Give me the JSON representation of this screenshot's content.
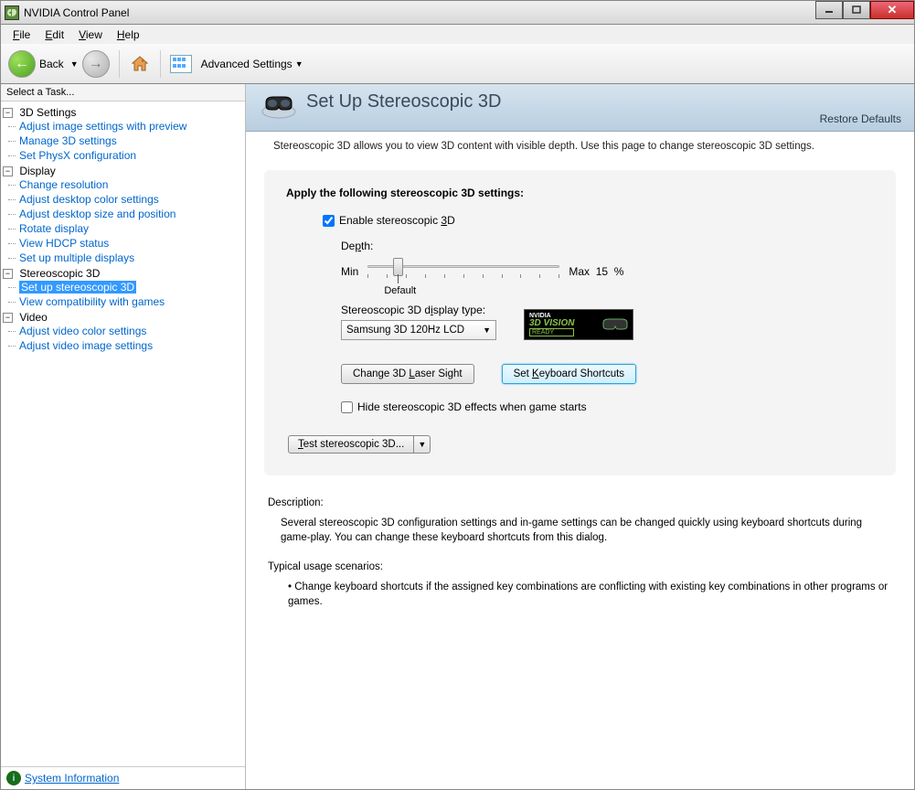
{
  "window": {
    "title": "NVIDIA Control Panel"
  },
  "menubar": {
    "file": "File",
    "edit": "Edit",
    "view": "View",
    "help": "Help"
  },
  "toolbar": {
    "back": "Back",
    "advanced": "Advanced Settings"
  },
  "sidebar": {
    "header": "Select a Task...",
    "groups": [
      {
        "label": "3D Settings",
        "items": [
          "Adjust image settings with preview",
          "Manage 3D settings",
          "Set PhysX configuration"
        ]
      },
      {
        "label": "Display",
        "items": [
          "Change resolution",
          "Adjust desktop color settings",
          "Adjust desktop size and position",
          "Rotate display",
          "View HDCP status",
          "Set up multiple displays"
        ]
      },
      {
        "label": "Stereoscopic 3D",
        "items": [
          "Set up stereoscopic 3D",
          "View compatibility with games"
        ]
      },
      {
        "label": "Video",
        "items": [
          "Adjust video color settings",
          "Adjust video image settings"
        ]
      }
    ],
    "selected": "Set up stereoscopic 3D",
    "system_info": "System Information"
  },
  "page": {
    "title": "Set Up Stereoscopic 3D",
    "restore": "Restore Defaults",
    "intro": "Stereoscopic 3D allows you to view 3D content with visible depth. Use this page to change stereoscopic 3D settings."
  },
  "settings": {
    "panel_title": "Apply the following stereoscopic 3D settings:",
    "enable_label": "Enable stereoscopic 3D",
    "enable_checked": true,
    "depth_label": "Depth:",
    "depth_min": "Min",
    "depth_max": "Max",
    "depth_value": "15",
    "depth_unit": "%",
    "depth_default": "Default",
    "display_type_label": "Stereoscopic 3D display type:",
    "display_type_value": "Samsung 3D 120Hz LCD",
    "badge": {
      "brand": "NVIDIA",
      "product": "3D VISION",
      "ready": "READY"
    },
    "btn_laser": "Change 3D Laser Sight",
    "btn_shortcuts": "Set Keyboard Shortcuts",
    "hide_label": "Hide stereoscopic 3D effects when game starts",
    "hide_checked": false,
    "test_btn": "Test stereoscopic 3D..."
  },
  "description": {
    "title": "Description:",
    "body": "Several stereoscopic 3D configuration settings and in-game settings can be changed quickly using keyboard shortcuts during game-play. You can change these keyboard shortcuts from this dialog.",
    "scenarios_title": "Typical usage scenarios:",
    "scenario1": "Change keyboard shortcuts if the assigned key combinations are conflicting with existing key combinations in other programs or games."
  }
}
